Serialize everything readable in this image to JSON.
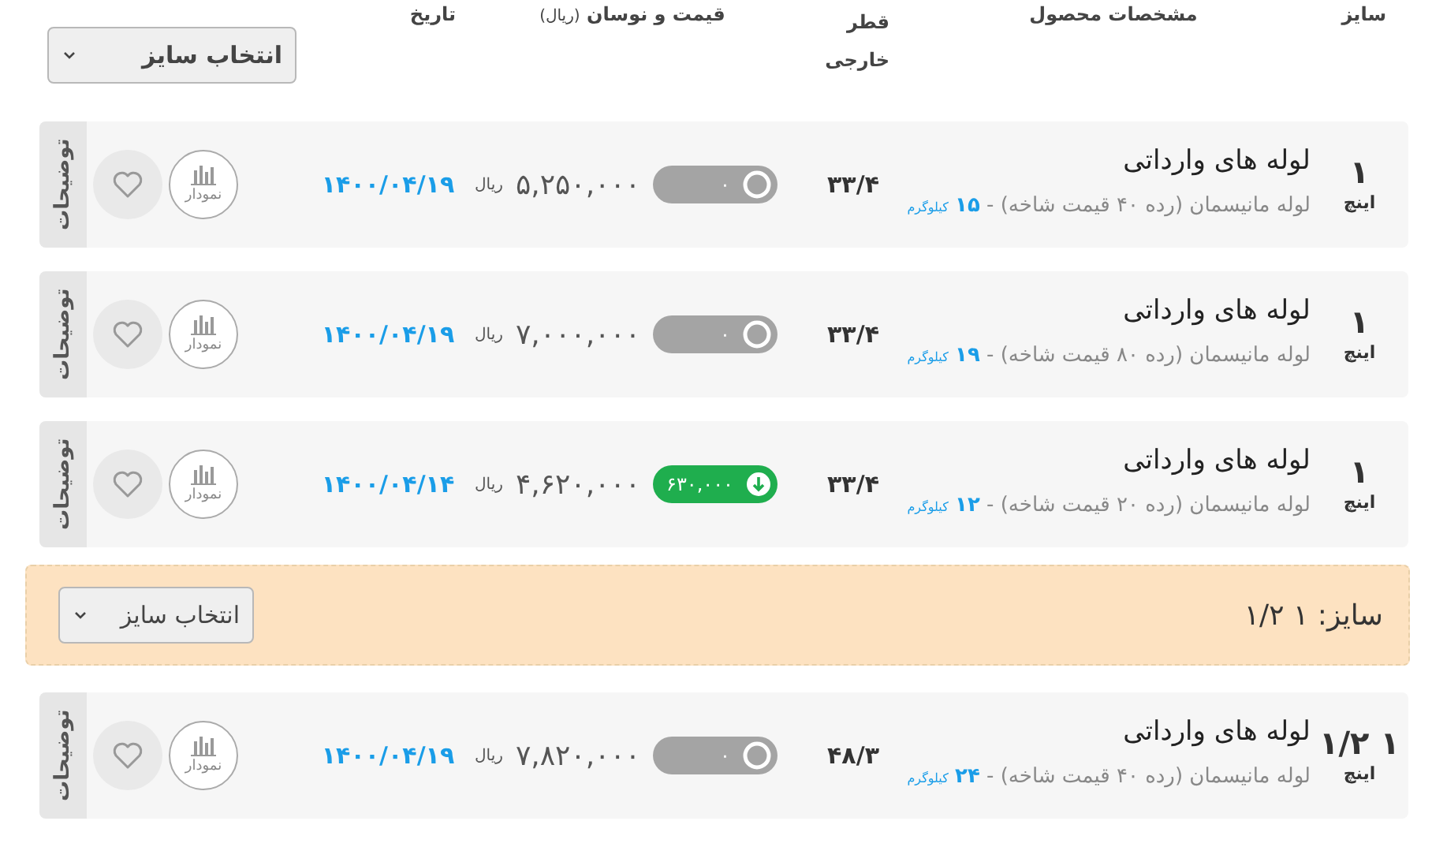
{
  "header": {
    "columns": [
      "سایز",
      "مشخصات محصول",
      "قطر خارجی",
      "قیمت و نوسان",
      "تاریخ"
    ],
    "price_unit": "(ریال)",
    "size_select": "انتخاب سایز"
  },
  "groups": [
    {
      "rows": [
        {
          "size": "۱",
          "unit": "اینچ",
          "title": "لوله های وارداتی",
          "spec": "لوله مانیسمان (رده ۴۰ قیمت شاخه) - ",
          "weight": "۱۵",
          "weight_unit": "کیلوگرم",
          "diameter": "۳۳/۴",
          "change": {
            "kind": "flat",
            "value": "۰"
          },
          "price": "۵,۲۵۰,۰۰۰",
          "currency": "ریال",
          "date": "۱۴۰۰/۰۴/۱۹",
          "chart_label": "نمودار",
          "notes": "توضیحات"
        },
        {
          "size": "۱",
          "unit": "اینچ",
          "title": "لوله های وارداتی",
          "spec": "لوله مانیسمان (رده ۸۰ قیمت شاخه) - ",
          "weight": "۱۹",
          "weight_unit": "کیلوگرم",
          "diameter": "۳۳/۴",
          "change": {
            "kind": "flat",
            "value": "۰"
          },
          "price": "۷,۰۰۰,۰۰۰",
          "currency": "ریال",
          "date": "۱۴۰۰/۰۴/۱۹",
          "chart_label": "نمودار",
          "notes": "توضیحات"
        },
        {
          "size": "۱",
          "unit": "اینچ",
          "title": "لوله های وارداتی",
          "spec": "لوله مانیسمان (رده ۲۰ قیمت شاخه) - ",
          "weight": "۱۲",
          "weight_unit": "کیلوگرم",
          "diameter": "۳۳/۴",
          "change": {
            "kind": "down",
            "value": "۶۳۰,۰۰۰"
          },
          "price": "۴,۶۲۰,۰۰۰",
          "currency": "ریال",
          "date": "۱۴۰۰/۰۴/۱۴",
          "chart_label": "نمودار",
          "notes": "توضیحات"
        }
      ]
    },
    {
      "band": {
        "label": "سایز:",
        "size": "۱ ۱/۲",
        "select": "انتخاب سایز"
      },
      "rows": [
        {
          "size": "۱ ۱/۲",
          "unit": "اینچ",
          "title": "لوله های وارداتی",
          "spec": "لوله مانیسمان (رده ۴۰ قیمت شاخه) - ",
          "weight": "۲۴",
          "weight_unit": "کیلوگرم",
          "diameter": "۴۸/۳",
          "change": {
            "kind": "flat",
            "value": "۰"
          },
          "price": "۷,۸۲۰,۰۰۰",
          "currency": "ریال",
          "date": "۱۴۰۰/۰۴/۱۹",
          "chart_label": "نمودار",
          "notes": "توضیحات"
        }
      ]
    }
  ]
}
